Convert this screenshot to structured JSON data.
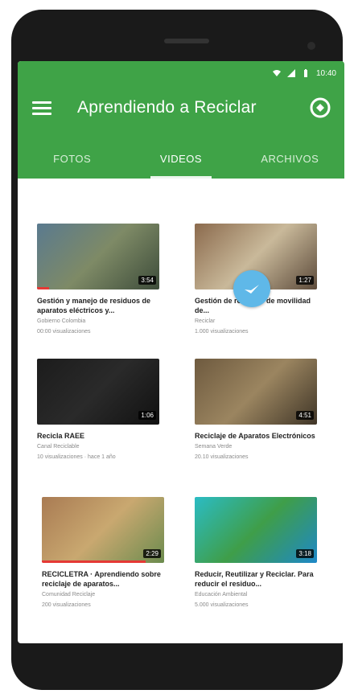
{
  "app": {
    "title": "Aprendiendo a Reciclar",
    "status_time": "10:40",
    "brand_color": "#3fa347"
  },
  "tabs": [
    {
      "label": "FOTOS",
      "active": false
    },
    {
      "label": "VIDEOS",
      "active": true
    },
    {
      "label": "ARCHIVOS",
      "active": false
    }
  ],
  "videos": [
    {
      "title": "Gestión y manejo de residuos de aparatos eléctricos y...",
      "channel": "Gobierno Colombia",
      "meta": "00:00 visualizaciones",
      "duration": "3:54",
      "thumb_colors": [
        "#5a7a8f",
        "#7e8a66",
        "#3d4c3a"
      ],
      "progress": 0.1
    },
    {
      "title": "Gestión de residuos de movilidad de...",
      "channel": "Reciclar",
      "meta": "1.000 visualizaciones",
      "duration": "1:27",
      "thumb_colors": [
        "#8b6a4d",
        "#c9b99a",
        "#5c4a3a"
      ],
      "progress": 0.0
    },
    {
      "title": "Recicla RAEE",
      "channel": "Canal Reciclable",
      "meta": "10 visualizaciones · hace 1 año",
      "duration": "1:06",
      "thumb_colors": [
        "#1c1c1c",
        "#2a2a2a",
        "#111111"
      ],
      "progress": 0.0
    },
    {
      "title": "Reciclaje de Aparatos Electrónicos",
      "channel": "Semana Verde",
      "meta": "20.10 visualizaciones",
      "duration": "4:51",
      "thumb_colors": [
        "#6e5a3f",
        "#9b8560",
        "#3f3527"
      ],
      "progress": 0.0
    },
    {
      "title": "RECICLETRA · Aprendiendo sobre reciclaje de aparatos...",
      "channel": "Comunidad Reciclaje",
      "meta": "200 visualizaciones",
      "duration": "2:29",
      "thumb_colors": [
        "#a97b53",
        "#c9a870",
        "#6b8b4e"
      ],
      "progress": 0.85
    },
    {
      "title": "Reducir, Reutilizar y Reciclar. Para reducir el residuo...",
      "channel": "Educación Ambiental",
      "meta": "5.000 visualizaciones",
      "duration": "3:18",
      "thumb_colors": [
        "#2bbcc4",
        "#3f9e49",
        "#1e88c8"
      ],
      "progress": 0.0
    }
  ],
  "icons": {
    "menu": "menu-icon",
    "action": "globe-refresh-icon",
    "floating": "play-overlay-icon"
  }
}
